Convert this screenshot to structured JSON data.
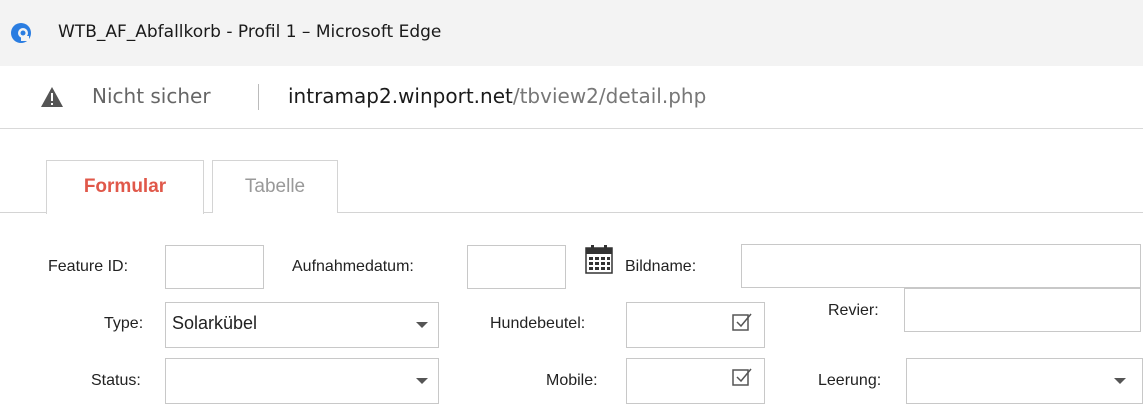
{
  "window": {
    "title": "WTB_AF_Abfallkorb - Profil 1 – Microsoft Edge",
    "app_icon": "edge-logo-icon"
  },
  "address_bar": {
    "security_label": "Nicht sicher",
    "security_icon": "warning-icon",
    "url_host": "intramap2.winport.net",
    "url_path": "/tbview2/detail.php"
  },
  "tabs": [
    {
      "label": "Formular",
      "active": true,
      "color": "#e0584a"
    },
    {
      "label": "Tabelle",
      "active": false
    }
  ],
  "form": {
    "feature_id": {
      "label": "Feature ID:",
      "value": ""
    },
    "aufnahmedatum": {
      "label": "Aufnahmedatum:",
      "value": "",
      "icon": "calendar-icon"
    },
    "bildname": {
      "label": "Bildname:",
      "value": ""
    },
    "type": {
      "label": "Type:",
      "value": "Solarkübel"
    },
    "hundebeutel": {
      "label": "Hundebeutel:",
      "checked": false
    },
    "revier": {
      "label": "Revier:",
      "value": ""
    },
    "status": {
      "label": "Status:",
      "value": ""
    },
    "mobile": {
      "label": "Mobile:",
      "checked": false
    },
    "leerung": {
      "label": "Leerung:",
      "value": ""
    }
  }
}
